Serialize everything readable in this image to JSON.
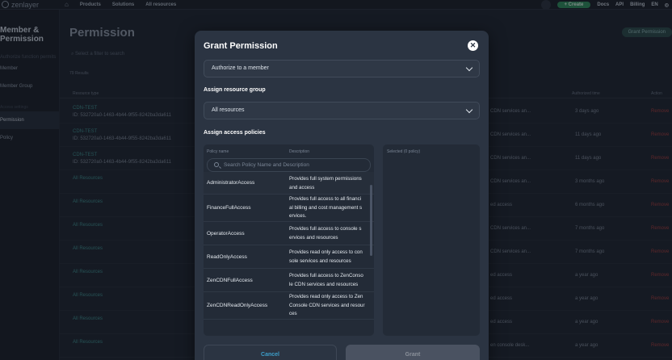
{
  "topbar": {
    "logo": "zenlayer",
    "nav": [
      "Products",
      "Solutions",
      "All resources"
    ],
    "create_label": "+ Create",
    "links": [
      "Docs",
      "API",
      "Billing",
      "EN"
    ]
  },
  "sidebar": {
    "title_line1": "Member &",
    "title_line2": "Permission",
    "filter_text": "Authorize function permits",
    "items": [
      {
        "label": "Member",
        "active": false
      },
      {
        "label": "Member Group",
        "active": false
      }
    ],
    "section_label": "Access settings",
    "items2": [
      {
        "label": "Permission",
        "active": true
      },
      {
        "label": "Policy",
        "active": false
      }
    ]
  },
  "page": {
    "title": "Permission",
    "grant_button": "Grant Permission",
    "filter_placeholder": "Select a filter to search",
    "results": "79 Results",
    "columns": {
      "resource_type": "Resource type",
      "authorized_time": "Authorized time",
      "action": "Action"
    },
    "rows": [
      {
        "name": "CDN-TEST",
        "id": "ID: 532720a0-1463-4b44-9f55-8242ba3da611",
        "desc": "CDN services an...",
        "time": "3 days ago",
        "action": "Remove"
      },
      {
        "name": "CDN-TEST",
        "id": "ID: 532720a0-1463-4b44-9f55-8242ba3da611",
        "desc": "CDN services an...",
        "time": "11 days ago",
        "action": "Remove"
      },
      {
        "name": "CDN-TEST",
        "id": "ID: 532720a0-1463-4b44-9f55-8242ba3da611",
        "desc": "CDN services an...",
        "time": "11 days ago",
        "action": "Remove"
      },
      {
        "name": "All Resources",
        "id": "",
        "desc": "CDN services an...",
        "time": "3 months ago",
        "action": "Remove"
      },
      {
        "name": "All Resources",
        "id": "",
        "desc": "ed access",
        "time": "6 months ago",
        "action": "Remove"
      },
      {
        "name": "All Resources",
        "id": "",
        "desc": "CDN services an...",
        "time": "7 months ago",
        "action": "Remove"
      },
      {
        "name": "All Resources",
        "id": "",
        "desc": "CDN services an...",
        "time": "7 months ago",
        "action": "Remove"
      },
      {
        "name": "All Resources",
        "id": "",
        "desc": "ed access",
        "time": "a year ago",
        "action": "Remove"
      },
      {
        "name": "All Resources",
        "id": "",
        "desc": "ed access",
        "time": "a year ago",
        "action": "Remove"
      },
      {
        "name": "All Resources",
        "id": "",
        "desc": "ed access",
        "time": "a year ago",
        "action": "Remove"
      },
      {
        "name": "All Resources",
        "id": "",
        "desc": "en console desk...",
        "time": "a year ago",
        "action": "Remove"
      }
    ]
  },
  "modal": {
    "title": "Grant Permission",
    "authorize_select": "Authorize to a member",
    "resource_group_label": "Assign resource group",
    "resource_group_select": "All resources",
    "access_policies_label": "Assign access policies",
    "policy_columns": {
      "name": "Policy name",
      "description": "Description"
    },
    "policy_search_placeholder": "Search Policy Name and Description",
    "policies": [
      {
        "name": "AdministratorAccess",
        "desc1": "Provides full system permissions",
        "desc2": "and access",
        "desc3": ""
      },
      {
        "name": "FinanceFullAccess",
        "desc1": "Provides full access to all financi",
        "desc2": "al billing and cost management s",
        "desc3": "ervices."
      },
      {
        "name": "OperatorAccess",
        "desc1": "Provides full access to console s",
        "desc2": "ervices and resources",
        "desc3": ""
      },
      {
        "name": "ReadOnlyAccess",
        "desc1": "Provides read only access to con",
        "desc2": "sole services and resources",
        "desc3": ""
      },
      {
        "name": "ZenCDNFullAccess",
        "desc1": "Provides full access to ZenConso",
        "desc2": "le CDN services and resources",
        "desc3": ""
      },
      {
        "name": "ZenCDNReadOnlyAccess",
        "desc1": "Provides read only access to Zen",
        "desc2": "Console CDN services and resour",
        "desc3": "ces"
      }
    ],
    "selected_label": "Selected (0 policy)",
    "cancel_label": "Cancel",
    "grant_label": "Grant"
  }
}
